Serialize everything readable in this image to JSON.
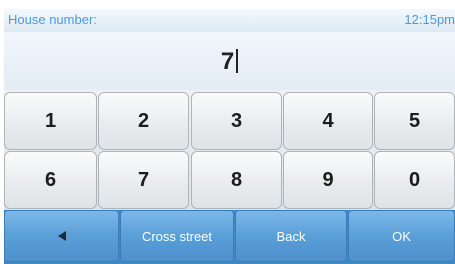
{
  "header": {
    "label": "House number:",
    "time": "12:15pm"
  },
  "entry": {
    "value": "7"
  },
  "keypad": {
    "row1": [
      "1",
      "2",
      "3",
      "4",
      "5"
    ],
    "row2": [
      "6",
      "7",
      "8",
      "9",
      "0"
    ]
  },
  "actions": {
    "back_icon": "left-arrow-icon",
    "cross_street_label": "Cross street",
    "back_label": "Back",
    "ok_label": "OK"
  },
  "colors": {
    "header_text": "#4c9bd2",
    "action_bar": "#3f89c6"
  }
}
